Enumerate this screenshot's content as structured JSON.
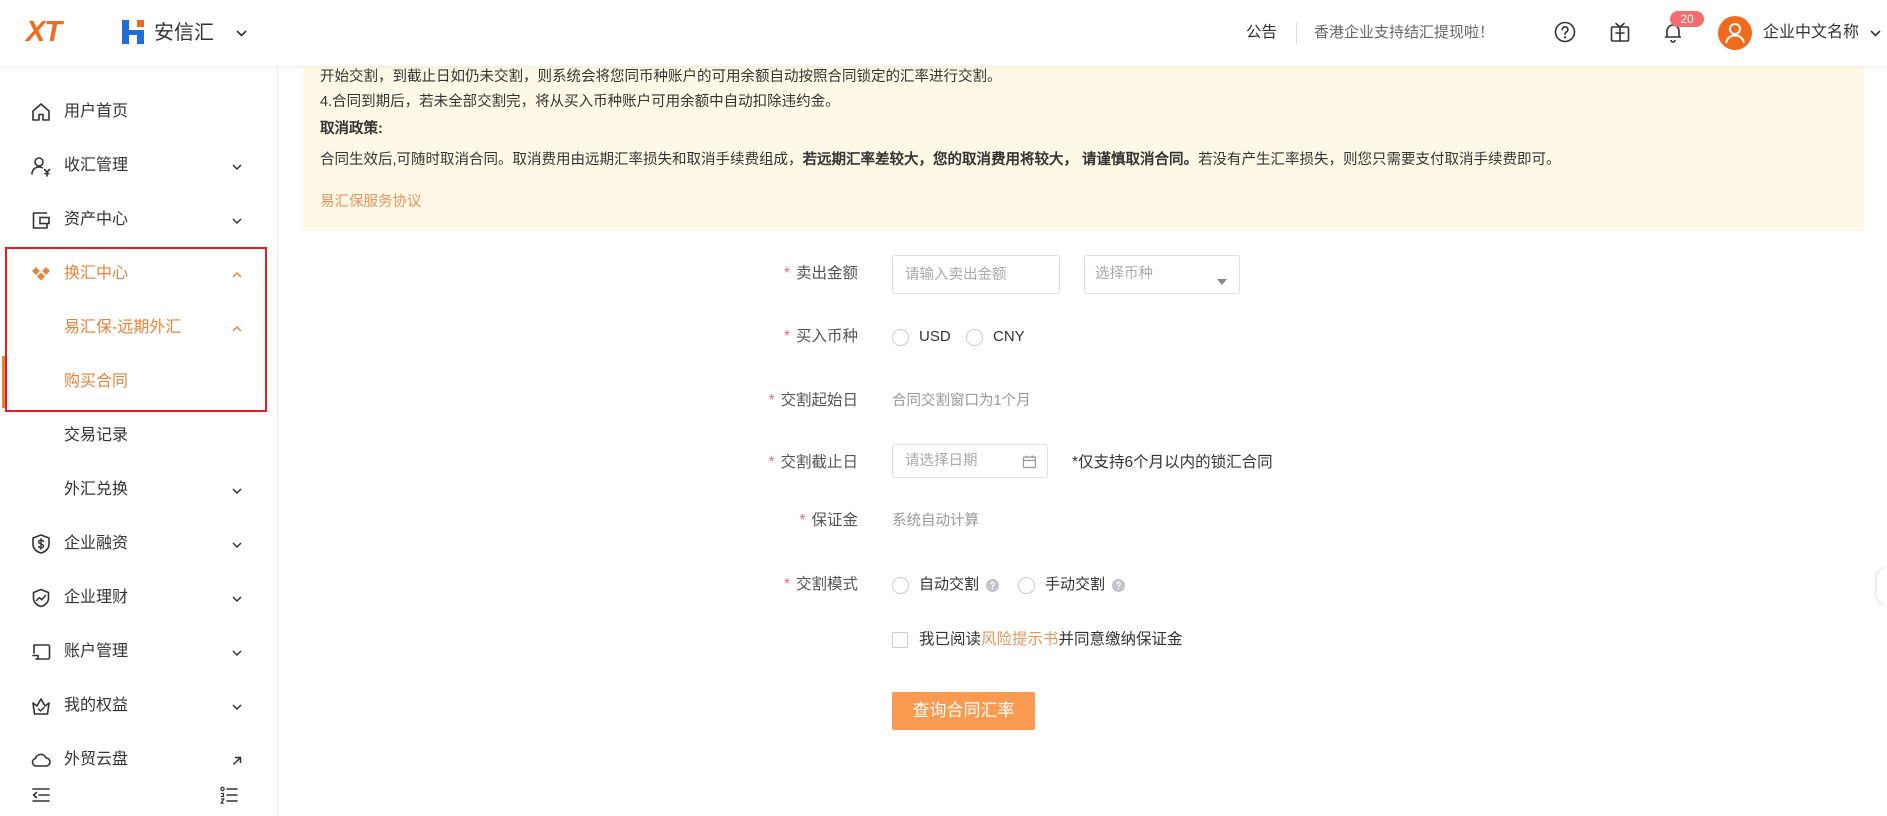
{
  "header": {
    "logo": "XT",
    "brand_name": "安信汇",
    "notice_label": "公告",
    "notice_text": "香港企业支持结汇提现啦！",
    "badge_count": "20",
    "company_name": "企业中文名称"
  },
  "sidebar": {
    "items": [
      {
        "label": "用户首页",
        "icon": "home-icon"
      },
      {
        "label": "收汇管理",
        "icon": "user-receive-icon"
      },
      {
        "label": "资产中心",
        "icon": "wallet-icon"
      },
      {
        "label": "换汇中心",
        "icon": "exchange-icon",
        "expanded": true
      },
      {
        "label": "易汇保-远期外汇",
        "expanded": true
      },
      {
        "label": "购买合同",
        "selected": true
      },
      {
        "label": "交易记录"
      },
      {
        "label": "外汇兑换"
      },
      {
        "label": "企业融资",
        "icon": "shield-dollar-icon"
      },
      {
        "label": "企业理财",
        "icon": "trend-icon"
      },
      {
        "label": "账户管理",
        "icon": "account-card-icon"
      },
      {
        "label": "我的权益",
        "icon": "crown-check-icon"
      },
      {
        "label": "外贸云盘",
        "icon": "cloud-icon"
      }
    ]
  },
  "notice": {
    "line1": "开始交割，到截止日如仍未交割，则系统会将您同币种账户的可用余额自动按照合同锁定的汇率进行交割。",
    "line2": "4.合同到期后，若未全部交割完，将从买入币种账户可用余额中自动扣除违约金。",
    "policy_title": "取消政策:",
    "policy_text_start": "合同生效后,可随时取消合同。取消费用由远期汇率损失和取消手续费组成，",
    "policy_text_bold": "若远期汇率差较大，您的取消费用将较大， 请谨慎取消合同。",
    "policy_text_end": "若没有产生汇率损失，则您只需要支付取消手续费即可。",
    "agreement_link": "易汇保服务协议"
  },
  "form": {
    "required_mark": "*",
    "sell_amount": {
      "label": "卖出金额",
      "placeholder": "请输入卖出金额",
      "currency_placeholder": "选择币种"
    },
    "buy_currency": {
      "label": "买入币种",
      "options": [
        "USD",
        "CNY"
      ]
    },
    "start_date": {
      "label": "交割起始日",
      "value": "合同交割窗口为1个月"
    },
    "end_date": {
      "label": "交割截止日",
      "placeholder": "请选择日期",
      "note": "*仅支持6个月以内的锁汇合同"
    },
    "deposit": {
      "label": "保证金",
      "value": "系统自动计算"
    },
    "mode": {
      "label": "交割模式",
      "options": [
        "自动交割",
        "手动交割"
      ]
    },
    "agreement": {
      "prefix": "我已阅读",
      "link": "风险提示书",
      "suffix": "并同意缴纳保证金"
    },
    "submit_label": "查询合同汇率"
  },
  "colors": {
    "accent": "#E8833A",
    "logo": "#F26B1D",
    "button": "#FA9A50",
    "badge": "#F56C6C",
    "notice_bg": "#FEF9E7",
    "highlight_box": "#E41E1E"
  }
}
